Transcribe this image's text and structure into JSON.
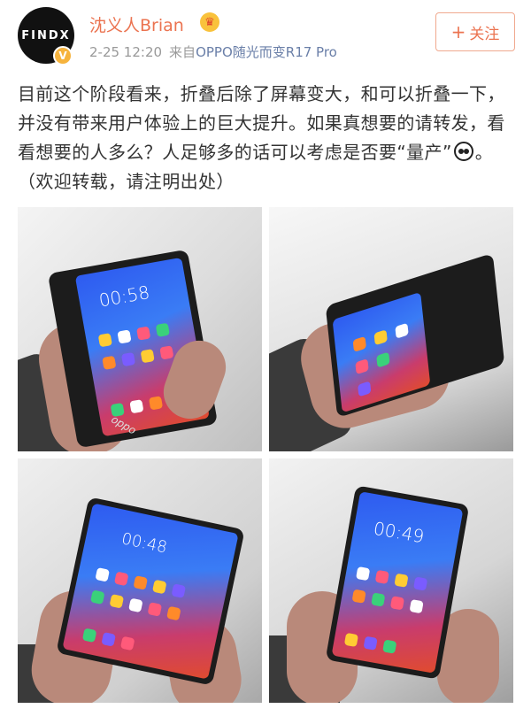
{
  "header": {
    "avatar_text": "FINDX",
    "verified_badge": "V",
    "username": "沈义人Brian",
    "crown_icon": "crown-icon",
    "time": "2-25 12:20",
    "source_prefix": "来自",
    "source": "OPPO随光而变R17 Pro",
    "follow_label": "关注",
    "follow_plus": "+"
  },
  "post": {
    "text_before_emoji": "目前这个阶段看来，折叠后除了屏幕变大，和可以折叠一下，并没有带来用户体验上的巨大提升。如果真想要的请转发，看看想要的人多么？人足够多的话可以考虑是否要“量产”",
    "text_after_emoji": "。（欢迎转载，请注明出处）",
    "emoji": "panda-emoji"
  },
  "photos": [
    {
      "clock": "00:58",
      "brand": "oppo"
    },
    {
      "clock": "",
      "brand": ""
    },
    {
      "clock": "00:48",
      "watermark": ""
    },
    {
      "clock": "00:49"
    }
  ],
  "colors": {
    "accent": "#eb7350",
    "source_link": "#6a7fa8",
    "text": "#333333",
    "meta": "#999999"
  }
}
